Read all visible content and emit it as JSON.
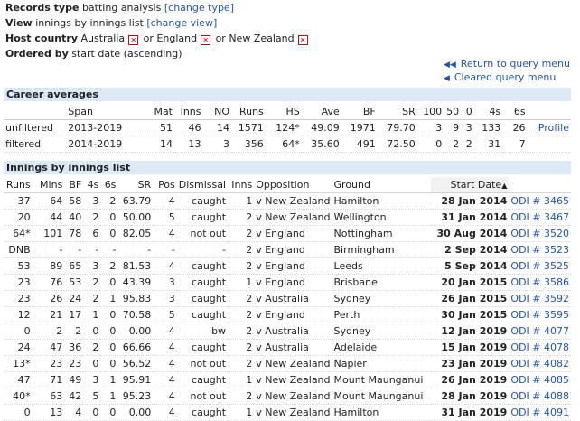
{
  "header": {
    "records_type_label": "Records type",
    "records_type_value": "batting analysis",
    "change_type": "[change type]",
    "view_label": "View",
    "view_value": "innings by innings list",
    "change_view": "[change view]",
    "host_label": "Host country",
    "host_c1": "Australia",
    "host_or1": "or England",
    "host_or2": "or New Zealand",
    "ordered_label": "Ordered by",
    "ordered_value": "start date (ascending)"
  },
  "links": {
    "return": "Return to query menu",
    "cleared": "Cleared query menu"
  },
  "career": {
    "title": "Career averages",
    "headers": [
      "",
      "Span",
      "Mat",
      "Inns",
      "NO",
      "Runs",
      "HS",
      "Ave",
      "BF",
      "SR",
      "100",
      "50",
      "0",
      "4s",
      "6s",
      ""
    ],
    "rows": [
      [
        "unfiltered",
        "2013-2019",
        "51",
        "46",
        "14",
        "1571",
        "124*",
        "49.09",
        "1971",
        "79.70",
        "3",
        "9",
        "3",
        "133",
        "26",
        "Profile"
      ],
      [
        "filtered",
        "2014-2019",
        "14",
        "13",
        "3",
        "356",
        "64*",
        "35.60",
        "491",
        "72.50",
        "0",
        "2",
        "2",
        "31",
        "7",
        ""
      ]
    ]
  },
  "innings": {
    "title": "Innings by innings list",
    "headers": [
      "Runs",
      "Mins",
      "BF",
      "4s",
      "6s",
      "SR",
      "Pos",
      "Dismissal",
      "Inns",
      "Opposition",
      "Ground",
      "Start Date",
      ""
    ],
    "sort_icon": "sort-ascending-icon",
    "rows": [
      [
        "37",
        "64",
        "58",
        "3",
        "2",
        "63.79",
        "4",
        "caught",
        "1",
        "v New Zealand",
        "Hamilton",
        "28 Jan 2014",
        "ODI # 3465"
      ],
      [
        "20",
        "44",
        "40",
        "2",
        "0",
        "50.00",
        "5",
        "caught",
        "2",
        "v New Zealand",
        "Wellington",
        "31 Jan 2014",
        "ODI # 3467"
      ],
      [
        "64*",
        "101",
        "78",
        "6",
        "0",
        "82.05",
        "4",
        "not out",
        "2",
        "v England",
        "Nottingham",
        "30 Aug 2014",
        "ODI # 3520"
      ],
      [
        "DNB",
        "-",
        "-",
        "-",
        "-",
        "-",
        "-",
        "-",
        "2",
        "v England",
        "Birmingham",
        "2 Sep 2014",
        "ODI # 3523"
      ],
      [
        "53",
        "89",
        "65",
        "3",
        "2",
        "81.53",
        "4",
        "caught",
        "2",
        "v England",
        "Leeds",
        "5 Sep 2014",
        "ODI # 3525"
      ],
      [
        "23",
        "76",
        "53",
        "2",
        "0",
        "43.39",
        "3",
        "caught",
        "1",
        "v England",
        "Brisbane",
        "20 Jan 2015",
        "ODI # 3586"
      ],
      [
        "23",
        "26",
        "24",
        "2",
        "1",
        "95.83",
        "3",
        "caught",
        "2",
        "v Australia",
        "Sydney",
        "26 Jan 2015",
        "ODI # 3592"
      ],
      [
        "12",
        "21",
        "17",
        "1",
        "0",
        "70.58",
        "5",
        "caught",
        "2",
        "v England",
        "Perth",
        "30 Jan 2015",
        "ODI # 3595"
      ],
      [
        "0",
        "2",
        "2",
        "0",
        "0",
        "0.00",
        "4",
        "lbw",
        "2",
        "v Australia",
        "Sydney",
        "12 Jan 2019",
        "ODI # 4077"
      ],
      [
        "24",
        "47",
        "36",
        "2",
        "0",
        "66.66",
        "4",
        "caught",
        "2",
        "v Australia",
        "Adelaide",
        "15 Jan 2019",
        "ODI # 4078"
      ],
      [
        "13*",
        "23",
        "23",
        "0",
        "0",
        "56.52",
        "4",
        "not out",
        "2",
        "v New Zealand",
        "Napier",
        "23 Jan 2019",
        "ODI # 4082"
      ],
      [
        "47",
        "71",
        "49",
        "3",
        "1",
        "95.91",
        "4",
        "caught",
        "1",
        "v New Zealand",
        "Mount Maunganui",
        "26 Jan 2019",
        "ODI # 4085"
      ],
      [
        "40*",
        "63",
        "42",
        "5",
        "1",
        "95.23",
        "4",
        "not out",
        "2",
        "v New Zealand",
        "Mount Maunganui",
        "28 Jan 2019",
        "ODI # 4088"
      ],
      [
        "0",
        "13",
        "4",
        "0",
        "0",
        "0.00",
        "4",
        "caught",
        "1",
        "v New Zealand",
        "Hamilton",
        "31 Jan 2019",
        "ODI # 4091"
      ]
    ]
  }
}
